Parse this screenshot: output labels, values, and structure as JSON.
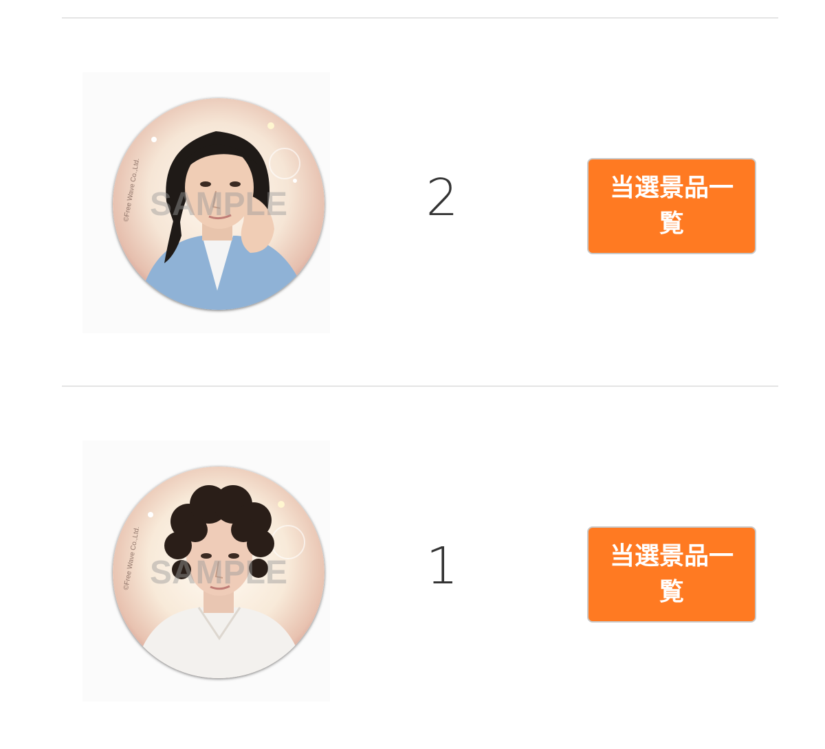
{
  "rows": [
    {
      "quantity": "2",
      "button_label": "当選景品一覧",
      "watermark": "SAMPLE",
      "copyright": "©Free Wave Co.,Ltd."
    },
    {
      "quantity": "1",
      "button_label": "当選景品一覧",
      "watermark": "SAMPLE",
      "copyright": "©Free Wave Co.,Ltd."
    }
  ],
  "colors": {
    "button_bg": "#ff7a22",
    "button_text": "#ffffff",
    "divider": "#e4e4e4",
    "quantity_text": "#333333"
  },
  "icons": {
    "badge_image": "can-badge-photo"
  }
}
